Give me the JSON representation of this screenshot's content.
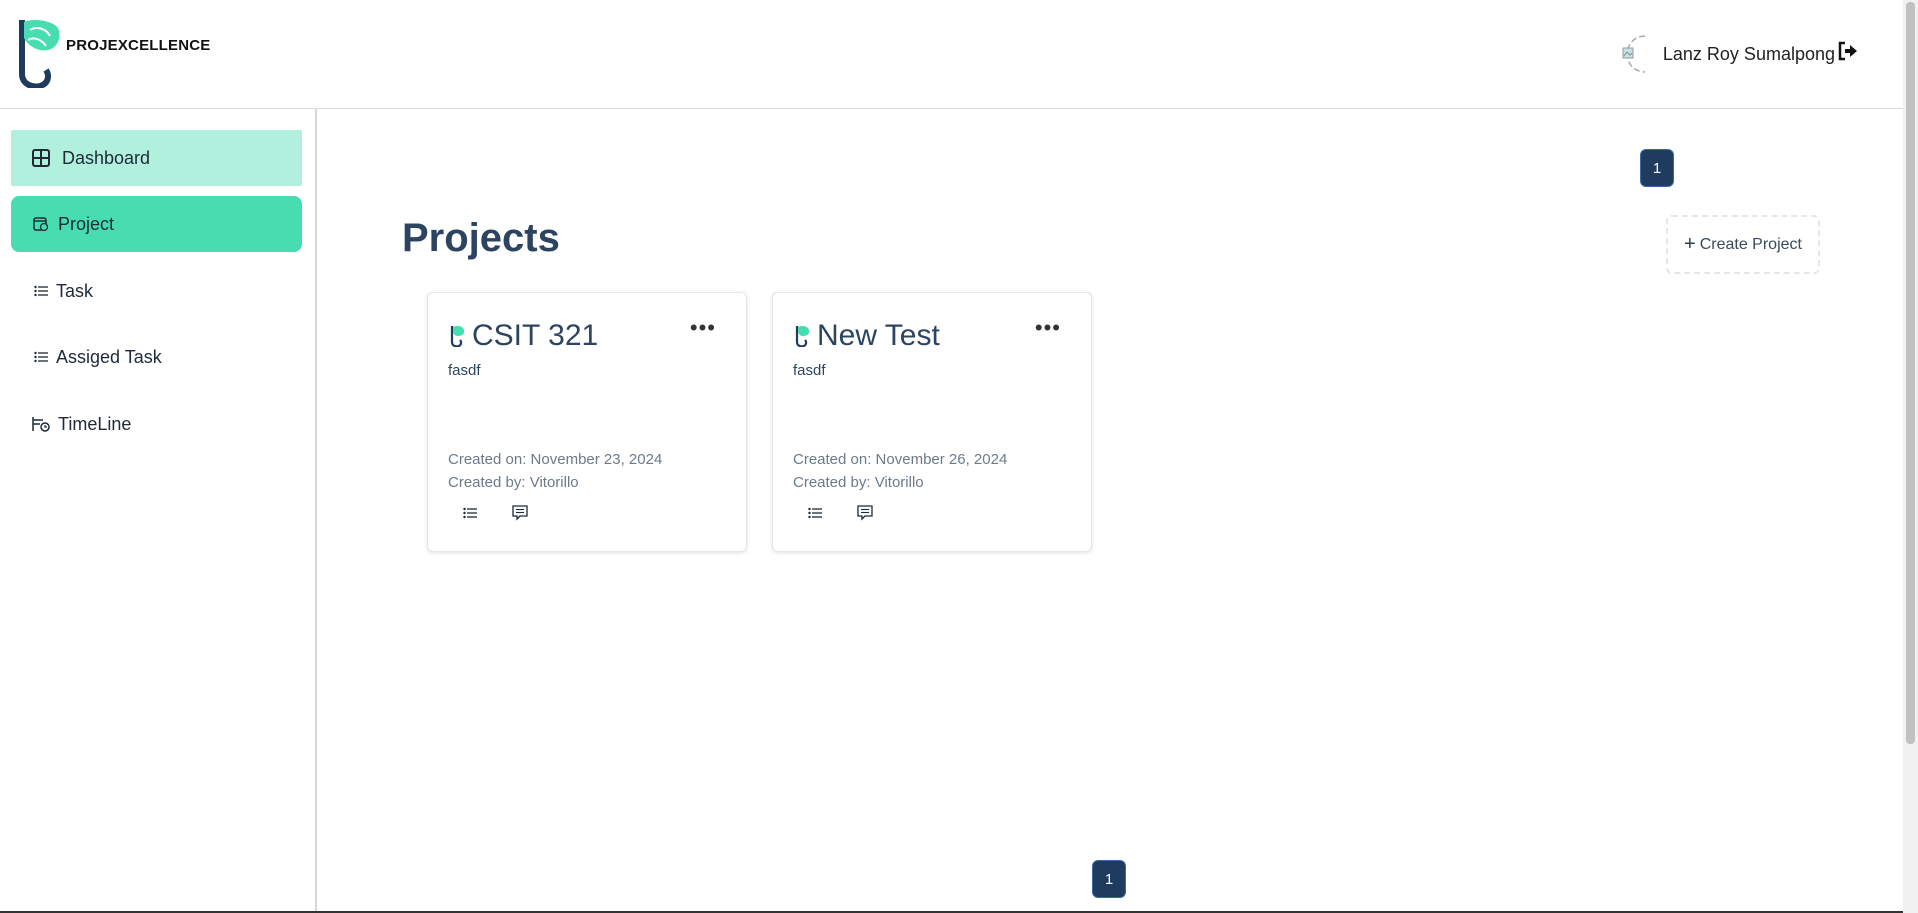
{
  "header": {
    "logo_text": "PROJEXCELLENCE",
    "user_name": "Lanz Roy Sumalpong",
    "logout_icon": "logout-icon"
  },
  "sidebar": {
    "items": [
      {
        "label": "Dashboard",
        "icon": "dashboard-grid-icon"
      },
      {
        "label": "Project",
        "icon": "project-icon"
      },
      {
        "label": "Task",
        "icon": "list-icon"
      },
      {
        "label": "Assiged Task",
        "icon": "list-icon"
      },
      {
        "label": "TimeLine",
        "icon": "timeline-icon"
      }
    ]
  },
  "main": {
    "title": "Projects",
    "create_button": "Create Project",
    "page_top": "1",
    "page_bottom": "1",
    "projects": [
      {
        "name": "CSIT 321",
        "description": "fasdf",
        "created_on": "Created on: November 23, 2024",
        "created_by": "Created by: Vitorillo"
      },
      {
        "name": "New Test",
        "description": "fasdf",
        "created_on": "Created on: November 26, 2024",
        "created_by": "Created by: Vitorillo"
      }
    ]
  },
  "colors": {
    "accent_active": "#48ddb0",
    "accent_light": "#b0f0dc",
    "page_badge": "#1f3b5e",
    "title": "#2d4460"
  }
}
